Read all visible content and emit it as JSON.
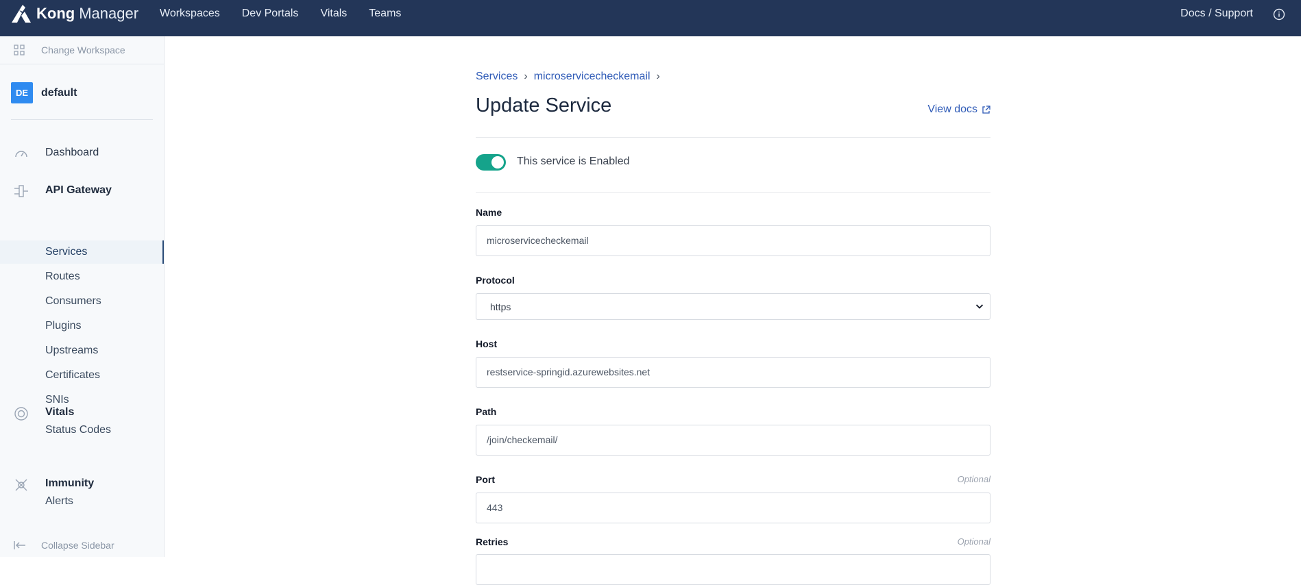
{
  "topbar": {
    "brand_bold": "Kong",
    "brand_light": "Manager",
    "nav": [
      "Workspaces",
      "Dev Portals",
      "Vitals",
      "Teams"
    ],
    "docs_support": "Docs / Support",
    "bg_color": "#233658"
  },
  "sidebar": {
    "change_workspace": "Change Workspace",
    "workspace_badge": "DE",
    "workspace_name": "default",
    "dashboard": "Dashboard",
    "api_gateway": "API Gateway",
    "api_items": [
      "Services",
      "Routes",
      "Consumers",
      "Plugins",
      "Upstreams",
      "Certificates",
      "SNIs"
    ],
    "active_item": "Services",
    "vitals": "Vitals",
    "vitals_items": [
      "Status Codes"
    ],
    "immunity": "Immunity",
    "immunity_items": [
      "Alerts"
    ],
    "collapse": "Collapse Sidebar"
  },
  "main": {
    "breadcrumb": [
      "Services",
      "microservicecheckemail"
    ],
    "breadcrumb_separator": "›",
    "title": "Update Service",
    "view_docs": "View docs",
    "toggle": {
      "enabled": true,
      "label": "This service is Enabled",
      "color": "#15a38b"
    },
    "fields": {
      "name": {
        "label": "Name",
        "value": "microservicecheckemail"
      },
      "protocol": {
        "label": "Protocol",
        "value": "https"
      },
      "host": {
        "label": "Host",
        "value": "restservice-springid.azurewebsites.net"
      },
      "path": {
        "label": "Path",
        "value": "/join/checkemail/"
      },
      "port": {
        "label": "Port",
        "value": "443",
        "hint": "Optional"
      },
      "retries": {
        "label": "Retries",
        "hint": "Optional"
      }
    }
  }
}
